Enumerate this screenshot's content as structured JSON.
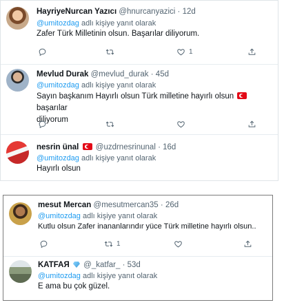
{
  "reply_prefix": "adlı kişiye yanıt olarak",
  "tweets_top": [
    {
      "name": "HayriyeNurcan Yazıcı",
      "handle": "@hnurcanyazici",
      "time": "12d",
      "reply_to": "@umitozdag",
      "text": "Zafer Türk Milletinin olsun. Başarılar diliyorum.",
      "counts": {
        "reply": "",
        "retweet": "",
        "like": "1"
      }
    },
    {
      "name": "Mevlud Durak",
      "handle": "@mevlud_durak",
      "time": "45d",
      "reply_to": "@umitozdag",
      "text_a": "Sayın başkanım Hayırlı olsun Türk milletine hayırlı olsun",
      "text_b": "başarılar",
      "text_c": "diliyorum",
      "counts": {
        "reply": "",
        "retweet": "",
        "like": ""
      }
    },
    {
      "name": "nesrin ünal",
      "handle": "@uzdrnesrinunal",
      "time": "16d",
      "reply_to": "@umitozdag",
      "text": "Hayırlı olsun"
    }
  ],
  "tweets_bottom": [
    {
      "name": "mesut Mercan",
      "handle": "@mesutmercan35",
      "time": "26d",
      "reply_to": "@umitozdag",
      "text": "Kutlu olsun Zafer inananlarındır yüce Türk milletine hayırlı olsun..",
      "counts": {
        "reply": "",
        "retweet": "1",
        "like": ""
      }
    },
    {
      "name": "KATFAЯ",
      "handle": "@_katfar_",
      "time": "53d",
      "reply_to": "@umitozdag",
      "text": "E ama bu çok güzel."
    }
  ],
  "separator": "·",
  "icons": [
    "reply-icon",
    "retweet-icon",
    "like-icon",
    "share-icon",
    "turkish-flag-icon",
    "diamond-icon"
  ],
  "colors": {
    "link": "#1d9bf0",
    "muted": "#536471",
    "text": "#0f1419",
    "flag": "#e30a17"
  }
}
